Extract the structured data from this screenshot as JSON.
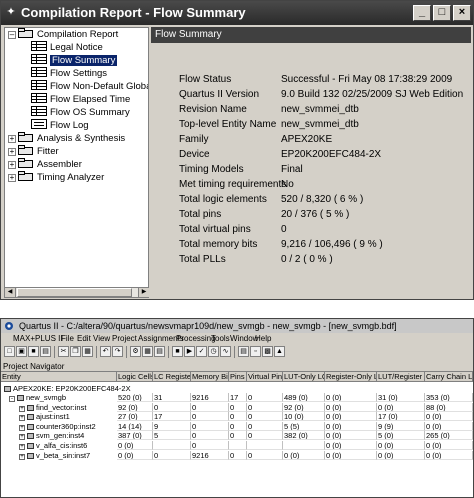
{
  "report_window": {
    "title": "Compilation Report - Flow Summary",
    "tree": {
      "root": "Compilation Report",
      "items": [
        "Legal Notice",
        "Flow Summary",
        "Flow Settings",
        "Flow Non-Default Global S",
        "Flow Elapsed Time",
        "Flow OS Summary",
        "Flow Log",
        "Analysis & Synthesis",
        "Fitter",
        "Assembler",
        "Timing Analyzer"
      ],
      "selected": "Flow Summary"
    },
    "panel_title": "Flow Summary",
    "summary": [
      {
        "label": "Flow Status",
        "value": "Successful - Fri May 08 17:38:29 2009"
      },
      {
        "label": "Quartus II Version",
        "value": "9.0 Build 132 02/25/2009 SJ Web Edition"
      },
      {
        "label": "Revision Name",
        "value": "new_svmmei_dtb"
      },
      {
        "label": "Top-level Entity Name",
        "value": "new_svmmei_dtb"
      },
      {
        "label": "Family",
        "value": "APEX20KE"
      },
      {
        "label": "Device",
        "value": "EP20K200EFC484-2X"
      },
      {
        "label": "Timing Models",
        "value": "Final"
      },
      {
        "label": "Met timing requirements",
        "value": "No"
      },
      {
        "label": "Total logic elements",
        "value": "520 / 8,320 ( 6 % )"
      },
      {
        "label": "Total pins",
        "value": "20 / 376 ( 5 % )"
      },
      {
        "label": "Total virtual pins",
        "value": "0"
      },
      {
        "label": "Total memory bits",
        "value": "9,216 / 106,496 ( 9 % )"
      },
      {
        "label": "Total PLLs",
        "value": "0 / 2 ( 0 % )"
      }
    ]
  },
  "quartus_window": {
    "title": "Quartus II - C:/altera/90/quartus/newsvmapr109d/new_svmgb - new_svmgb - [new_svmgb.bdf]",
    "menus": [
      "MAX+PLUS II",
      "File",
      "Edit",
      "View",
      "Project",
      "Assignments",
      "Processing",
      "Tools",
      "Window",
      "Help"
    ],
    "navigator_label": "Project Navigator",
    "columns": [
      "Entity",
      "Logic Cells",
      "LC Registers",
      "Memory Bits",
      "Pins",
      "Virtual Pins",
      "LUT-Only LCs",
      "Register-Only LCs",
      "LUT/Register LCs",
      "Carry Chain LCs"
    ],
    "device_row": "APEX20KE: EP20K200EFC484-2X",
    "rows": [
      {
        "entity": "new_svmgb",
        "level": 0,
        "cells": [
          "520 (0)",
          "31",
          "9216",
          "17",
          "0",
          "489 (0)",
          "0 (0)",
          "31 (0)",
          "353 (0)"
        ]
      },
      {
        "entity": "find_vector:inst",
        "level": 1,
        "cells": [
          "92 (0)",
          "0",
          "0",
          "0",
          "0",
          "92 (0)",
          "0 (0)",
          "0 (0)",
          "88 (0)"
        ]
      },
      {
        "entity": "ajust:inst1",
        "level": 1,
        "cells": [
          "27 (0)",
          "17",
          "0",
          "0",
          "0",
          "10 (0)",
          "0 (0)",
          "17 (0)",
          "0 (0)"
        ]
      },
      {
        "entity": "counter360p:inst2",
        "level": 1,
        "cells": [
          "14 (14)",
          "9",
          "0",
          "0",
          "0",
          "5 (5)",
          "0 (0)",
          "9 (9)",
          "0 (0)"
        ]
      },
      {
        "entity": "svm_gen:inst4",
        "level": 1,
        "cells": [
          "387 (0)",
          "5",
          "0",
          "0",
          "0",
          "382 (0)",
          "0 (0)",
          "5 (0)",
          "265 (0)"
        ]
      },
      {
        "entity": "v_alfa_cis:inst6",
        "level": 1,
        "cells": [
          "0 (0)",
          "",
          "0",
          "",
          "",
          "",
          "0 (0)",
          "0 (0)",
          "0 (0)"
        ]
      },
      {
        "entity": "v_beta_sin:inst7",
        "level": 1,
        "cells": [
          "0 (0)",
          "0",
          "9216",
          "0",
          "0",
          "0 (0)",
          "0 (0)",
          "0 (0)",
          "0 (0)"
        ]
      }
    ]
  }
}
